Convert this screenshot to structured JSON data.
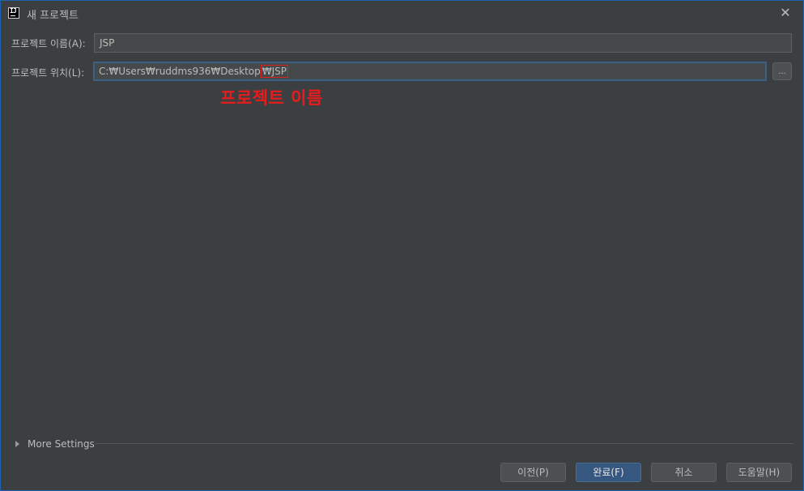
{
  "window": {
    "title": "새 프로젝트",
    "close_glyph": "✕",
    "app_icon_text": "IJ",
    "accent_color": "#1f63b0"
  },
  "form": {
    "name_label": "프로젝트 이름(A):",
    "name_value": "JSP",
    "location_label": "프로젝트 위치(L):",
    "location_prefix": "C:₩Users₩ruddms936₩Desktop",
    "location_highlight": "₩JSP",
    "browse_label": "..."
  },
  "annotation": {
    "text": "프로젝트 이름",
    "color": "#e81c1c"
  },
  "more_settings": {
    "label": "More Settings",
    "icon": "expand-triangle-icon"
  },
  "buttons": {
    "previous": "이전(P)",
    "finish": "완료(F)",
    "cancel": "취소",
    "help": "도움말(H)"
  }
}
